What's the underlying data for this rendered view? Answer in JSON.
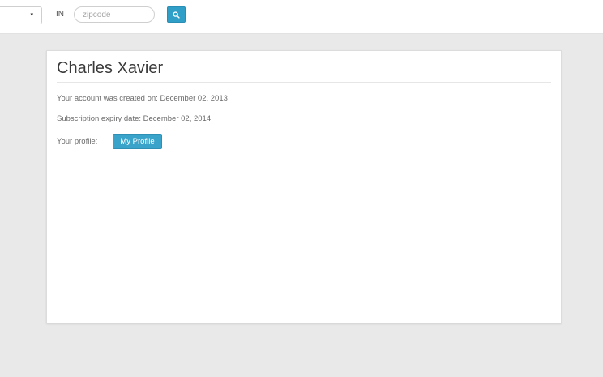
{
  "toolbar": {
    "country_label": "IN",
    "zipcode_placeholder": "zipcode",
    "zipcode_value": "",
    "select_caret": "▾"
  },
  "account": {
    "name": "Charles Xavier",
    "created_text": "Your account was created on: December 02, 2013",
    "expiry_text": "Subscription expiry date: December 02, 2014",
    "profile_label": "Your profile:",
    "profile_button": "My Profile"
  },
  "colors": {
    "accent": "#2f9fc8",
    "background": "#e9e9e9",
    "panel": "#ffffff"
  }
}
